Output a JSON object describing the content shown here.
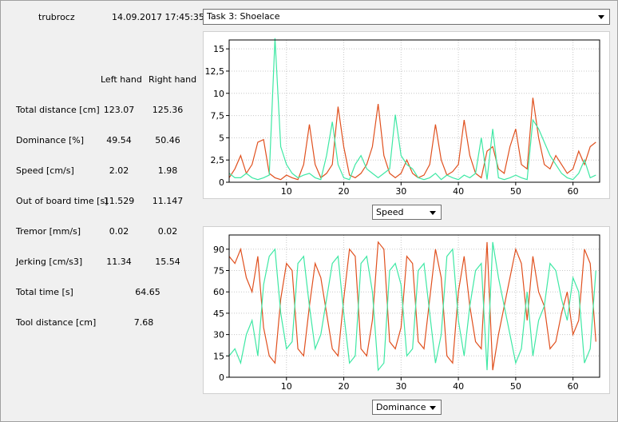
{
  "user": "trubrocz",
  "datetime": "14.09.2017 17:45:35",
  "task_select": {
    "value": "Task 3: Shoelace"
  },
  "headers": {
    "left": "Left hand",
    "right": "Right hand"
  },
  "stats": [
    {
      "label": "Total distance [cm]",
      "left": "123.07",
      "right": "125.36"
    },
    {
      "label": "Dominance [%]",
      "left": "49.54",
      "right": "50.46"
    },
    {
      "label": "Speed [cm/s]",
      "left": "2.02",
      "right": "1.98"
    },
    {
      "label": "Out of board time [s]",
      "left": "11.529",
      "right": "11.147"
    },
    {
      "label": "Tremor [mm/s]",
      "left": "0.02",
      "right": "0.02"
    },
    {
      "label": "Jerking [cm/s3]",
      "left": "11.34",
      "right": "15.54"
    }
  ],
  "totals": [
    {
      "label": "Total time [s]",
      "value": "64.65"
    },
    {
      "label": "Tool distance [cm]",
      "value": "7.68"
    }
  ],
  "chart_selects": {
    "top": "Speed",
    "bottom": "Dominance"
  },
  "colors": {
    "left": "#e0501e",
    "right": "#3ee8a4"
  },
  "chart_data": [
    {
      "type": "line",
      "xlim": [
        0,
        64.65
      ],
      "ylim": [
        0,
        16
      ],
      "x_ticks": [
        "10",
        "20",
        "30",
        "40",
        "50",
        "60"
      ],
      "y_ticks": [
        "0",
        "2,5",
        "5",
        "7,5",
        "10",
        "12,5",
        "15"
      ],
      "grid": true,
      "x": [
        0,
        1,
        2,
        3,
        4,
        5,
        6,
        7,
        8,
        9,
        10,
        11,
        12,
        13,
        14,
        15,
        16,
        17,
        18,
        19,
        20,
        21,
        22,
        23,
        24,
        25,
        26,
        27,
        28,
        29,
        30,
        31,
        32,
        33,
        34,
        35,
        36,
        37,
        38,
        39,
        40,
        41,
        42,
        43,
        44,
        45,
        46,
        47,
        48,
        49,
        50,
        51,
        52,
        53,
        54,
        55,
        56,
        57,
        58,
        59,
        60,
        61,
        62,
        63,
        64
      ],
      "series": [
        {
          "color": "#e0501e",
          "values": [
            0.5,
            1.5,
            3.0,
            1.0,
            2.0,
            4.5,
            4.8,
            1.0,
            0.5,
            0.3,
            0.8,
            0.5,
            0.3,
            2.0,
            6.5,
            2.0,
            0.5,
            1.0,
            2.0,
            8.5,
            4.0,
            0.8,
            0.5,
            1.0,
            2.0,
            4.0,
            8.8,
            3.0,
            1.0,
            0.5,
            1.0,
            2.5,
            1.0,
            0.5,
            0.8,
            2.0,
            6.5,
            2.5,
            0.8,
            1.2,
            2.0,
            7.0,
            3.0,
            1.0,
            0.5,
            3.5,
            4.0,
            1.5,
            1.0,
            4.0,
            6.0,
            2.0,
            1.5,
            9.5,
            5.0,
            2.0,
            1.5,
            3.0,
            2.0,
            1.0,
            1.5,
            3.5,
            2.0,
            4.0,
            4.5
          ]
        },
        {
          "color": "#3ee8a4",
          "values": [
            1.0,
            0.5,
            0.5,
            1.0,
            0.5,
            0.3,
            0.5,
            0.8,
            16.2,
            4.0,
            2.0,
            1.0,
            0.5,
            0.8,
            1.0,
            0.5,
            0.3,
            3.0,
            6.8,
            2.0,
            0.5,
            0.3,
            2.0,
            3.0,
            1.5,
            1.0,
            0.5,
            1.0,
            1.5,
            7.6,
            3.0,
            2.0,
            1.5,
            0.5,
            0.3,
            0.5,
            1.0,
            0.3,
            0.8,
            0.5,
            0.3,
            0.8,
            0.5,
            1.0,
            5.0,
            0.3,
            6.0,
            0.5,
            0.3,
            0.5,
            0.8,
            0.5,
            0.3,
            7.0,
            6.0,
            4.5,
            3.0,
            2.0,
            1.0,
            0.5,
            0.3,
            1.0,
            2.5,
            0.5,
            0.8
          ]
        }
      ]
    },
    {
      "type": "line",
      "xlim": [
        0,
        64.65
      ],
      "ylim": [
        0,
        100
      ],
      "x_ticks": [
        "10",
        "20",
        "30",
        "40",
        "50",
        "60"
      ],
      "y_ticks": [
        "0",
        "15",
        "30",
        "45",
        "60",
        "75",
        "90"
      ],
      "grid": true,
      "x": [
        0,
        1,
        2,
        3,
        4,
        5,
        6,
        7,
        8,
        9,
        10,
        11,
        12,
        13,
        14,
        15,
        16,
        17,
        18,
        19,
        20,
        21,
        22,
        23,
        24,
        25,
        26,
        27,
        28,
        29,
        30,
        31,
        32,
        33,
        34,
        35,
        36,
        37,
        38,
        39,
        40,
        41,
        42,
        43,
        44,
        45,
        46,
        47,
        48,
        49,
        50,
        51,
        52,
        53,
        54,
        55,
        56,
        57,
        58,
        59,
        60,
        61,
        62,
        63,
        64
      ],
      "series": [
        {
          "color": "#e0501e",
          "values": [
            85,
            80,
            90,
            70,
            60,
            85,
            35,
            15,
            10,
            55,
            80,
            75,
            20,
            15,
            50,
            80,
            70,
            45,
            20,
            15,
            55,
            90,
            85,
            20,
            15,
            40,
            95,
            90,
            25,
            20,
            35,
            85,
            80,
            25,
            20,
            55,
            90,
            70,
            15,
            10,
            60,
            85,
            50,
            25,
            20,
            95,
            5,
            30,
            50,
            70,
            90,
            80,
            40,
            85,
            60,
            50,
            20,
            25,
            45,
            60,
            30,
            40,
            90,
            80,
            25
          ]
        },
        {
          "color": "#3ee8a4",
          "values": [
            15,
            20,
            10,
            30,
            40,
            15,
            65,
            85,
            90,
            45,
            20,
            25,
            80,
            85,
            50,
            20,
            30,
            55,
            80,
            85,
            45,
            10,
            15,
            80,
            85,
            60,
            5,
            10,
            75,
            80,
            65,
            15,
            20,
            75,
            80,
            45,
            10,
            30,
            85,
            90,
            40,
            15,
            50,
            75,
            80,
            5,
            95,
            70,
            50,
            30,
            10,
            20,
            60,
            15,
            40,
            50,
            80,
            75,
            55,
            40,
            70,
            60,
            10,
            20,
            75
          ]
        }
      ]
    }
  ]
}
